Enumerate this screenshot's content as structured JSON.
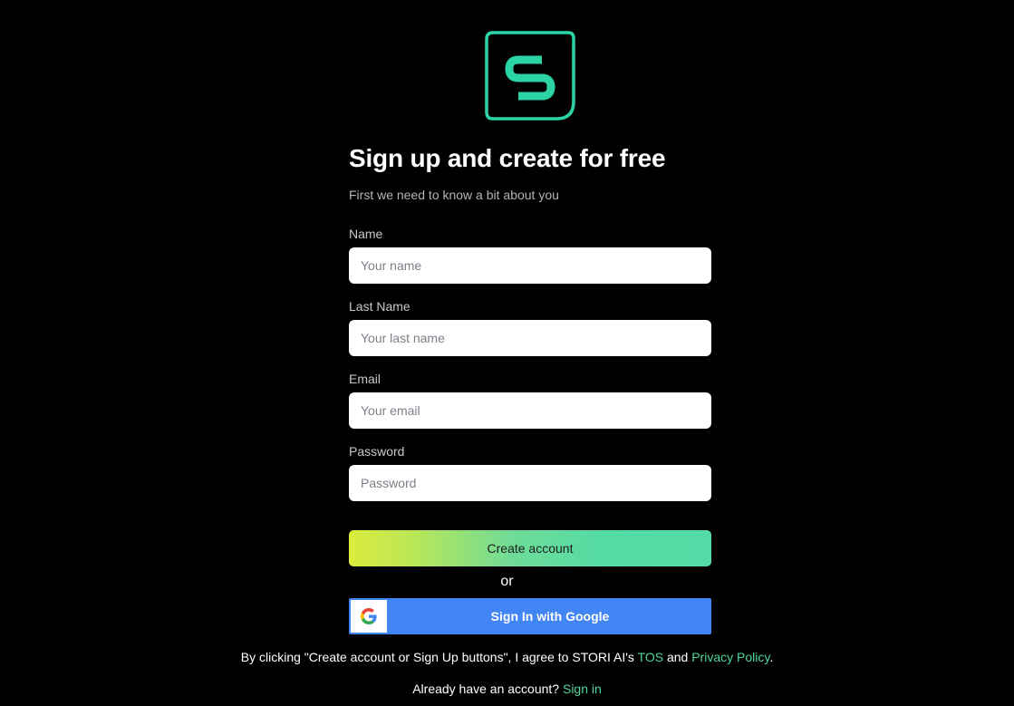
{
  "logo": {
    "icon": "stori-s-logo-icon",
    "accent_color": "#2bd4a4"
  },
  "header": {
    "title": "Sign up and create for free",
    "subtitle": "First we need to know a bit about you"
  },
  "form": {
    "name": {
      "label": "Name",
      "placeholder": "Your name",
      "value": ""
    },
    "last_name": {
      "label": "Last Name",
      "placeholder": "Your last name",
      "value": ""
    },
    "email": {
      "label": "Email",
      "placeholder": "Your email",
      "value": ""
    },
    "password": {
      "label": "Password",
      "placeholder": "Password",
      "value": ""
    }
  },
  "actions": {
    "create_label": "Create account",
    "or_label": "or",
    "google_label": "Sign In with Google",
    "google_icon": "google-g-icon",
    "google_color": "#4285f4"
  },
  "terms": {
    "prefix": "By clicking \"Create account or Sign Up buttons\", I agree to STORI AI's ",
    "tos_label": "TOS",
    "and_text": " and ",
    "privacy_label": "Privacy Policy",
    "suffix": "."
  },
  "footer": {
    "prompt": "Already have an account? ",
    "signin_label": "Sign in",
    "link_color": "#4fd69c"
  }
}
